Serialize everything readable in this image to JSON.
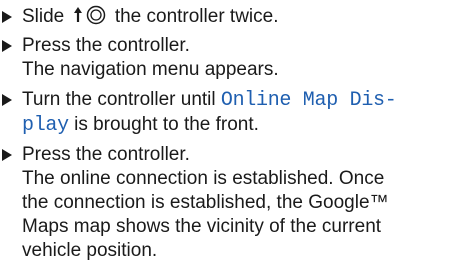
{
  "steps": [
    {
      "before_icon": "Slide",
      "icon": "slide-up-controller-icon",
      "after_icon": "the controller twice."
    },
    {
      "line1": "Press the controller.",
      "line2": "The navigation menu appears."
    },
    {
      "line1_prefix": "Turn the controller until",
      "line1_highlight": "Online Map Dis-",
      "line2_highlight": "play",
      "line2_suffix": "is brought to the front."
    },
    {
      "line1": "Press the controller.",
      "line2": "The online connection is established. Once",
      "line3": "the connection is established, the Google™",
      "line4": "Maps map shows the vicinity of the current",
      "line5": "vehicle position."
    }
  ],
  "colors": {
    "highlight": "#1f5fb0",
    "text": "#1a1a1a"
  }
}
